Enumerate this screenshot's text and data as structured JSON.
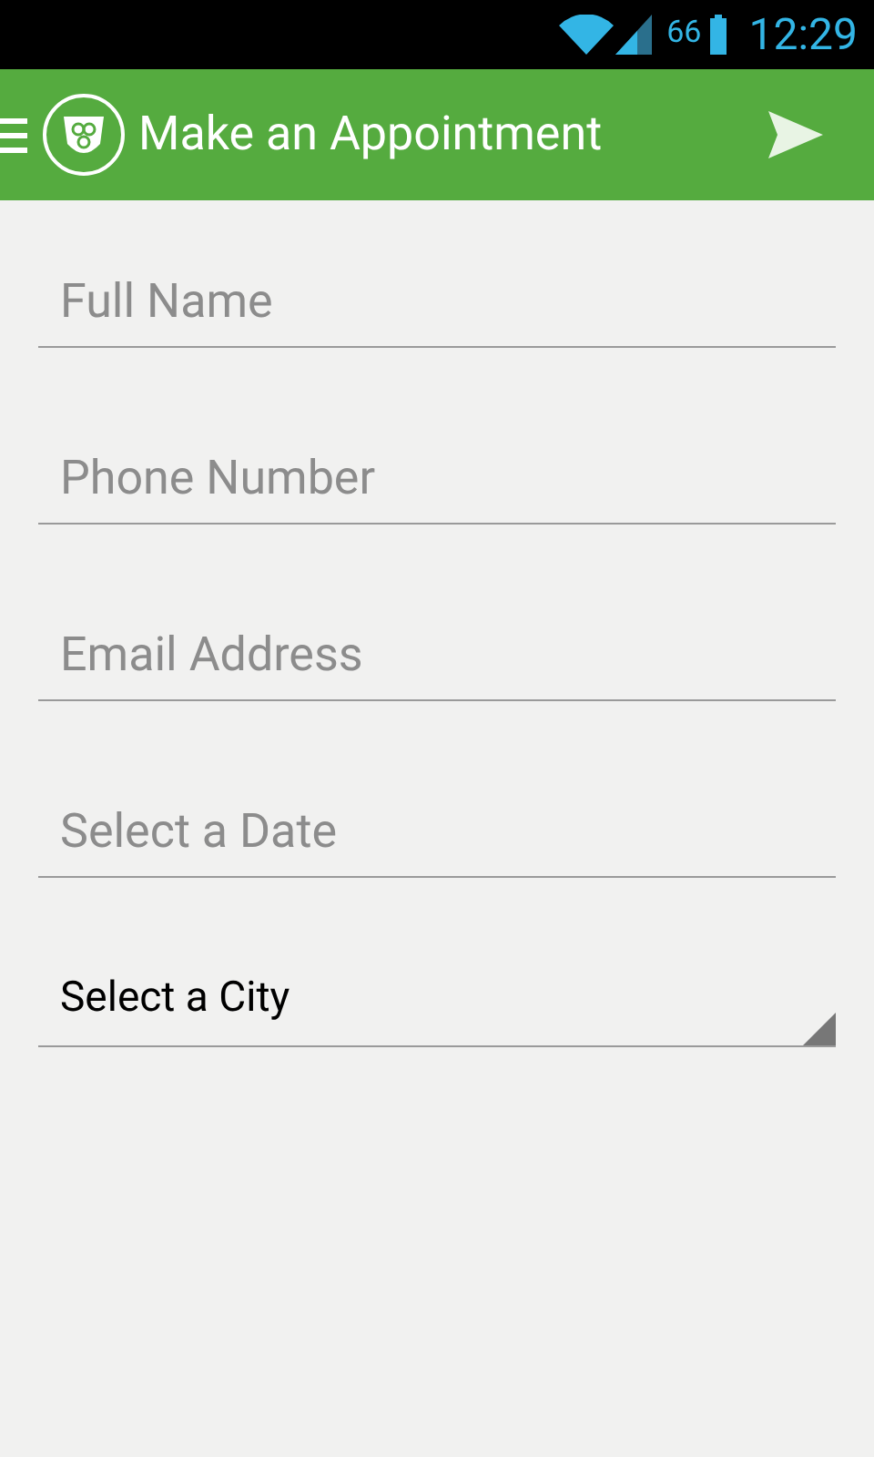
{
  "status_bar": {
    "battery": "66",
    "time": "12:29"
  },
  "app_bar": {
    "title": "Make an Appointment"
  },
  "fields": [
    {
      "kind": "text",
      "placeholder": "Full Name"
    },
    {
      "kind": "text",
      "placeholder": "Phone Number"
    },
    {
      "kind": "text",
      "placeholder": "Email Address"
    },
    {
      "kind": "text",
      "placeholder": "Select a Date"
    },
    {
      "kind": "spinner",
      "value": "Select a City"
    }
  ]
}
